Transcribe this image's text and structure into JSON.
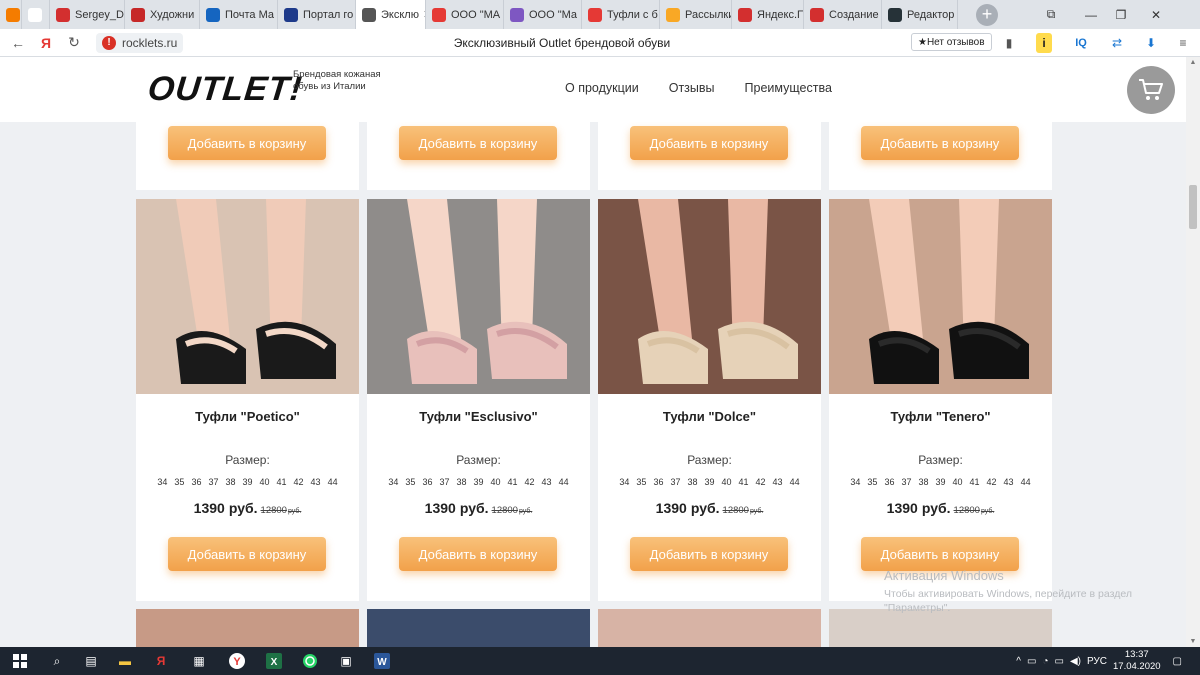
{
  "browser": {
    "tabs": [
      {
        "label": "",
        "favicon_color": "#f57c00",
        "favicon_icon": "blogger-icon"
      },
      {
        "label": "",
        "favicon_color": "#ffffff",
        "favicon_icon": "page-icon"
      },
      {
        "label": "Sergey_D",
        "favicon_color": "#d32f2f",
        "favicon_icon": "pdf-icon"
      },
      {
        "label": "Художни",
        "favicon_color": "#c62828",
        "favicon_icon": "frame-icon"
      },
      {
        "label": "Почта Ма",
        "favicon_color": "#1565c0",
        "favicon_icon": "mail-icon"
      },
      {
        "label": "Портал го",
        "favicon_color": "#1e3a8a",
        "favicon_icon": "flag-icon"
      },
      {
        "label": "Эксклю",
        "favicon_color": "#555555",
        "favicon_icon": "shoe-icon",
        "active": true
      },
      {
        "label": "ООО \"МА",
        "favicon_color": "#e53935",
        "favicon_icon": "yandex-icon"
      },
      {
        "label": "ООО \"Ма",
        "favicon_color": "#7e57c2",
        "favicon_icon": "globe-icon"
      },
      {
        "label": "Туфли с б",
        "favicon_color": "#e53935",
        "favicon_icon": "shop-icon"
      },
      {
        "label": "Рассылки",
        "favicon_color": "#f9a825",
        "favicon_icon": "envelope-icon"
      },
      {
        "label": "Яндекс.П",
        "favicon_color": "#d32f2f",
        "favicon_icon": "yandex-page-icon"
      },
      {
        "label": "Создание",
        "favicon_color": "#d32f2f",
        "favicon_icon": "yandex-page-icon"
      },
      {
        "label": "Редактор",
        "favicon_color": "#263238",
        "favicon_icon": "sparkle-icon"
      }
    ],
    "close_glyph": "✕",
    "new_tab_glyph": "+"
  },
  "addressbar": {
    "url": "rocklets.ru",
    "page_title": "Эксклюзивный Outlet брендовой обуви",
    "reviews_label": "★Нет отзывов",
    "yandex_glyph": "Я",
    "iq_label": "IQ"
  },
  "site": {
    "logo": "OUTLET!",
    "tagline": "Брендовая кожаная обувь из Италии",
    "nav": [
      "О продукции",
      "Отзывы",
      "Преимущества"
    ]
  },
  "cart_button_label": "Добавить в корзину",
  "size_label": "Размер:",
  "sizes": [
    "34",
    "35",
    "36",
    "37",
    "38",
    "39",
    "40",
    "41",
    "42",
    "43",
    "44"
  ],
  "currency": "руб.",
  "products": [
    {
      "name": "Туфли \"Poetico\"",
      "price": "1390",
      "old_price": "12800"
    },
    {
      "name": "Туфли \"Esclusivo\"",
      "price": "1390",
      "old_price": "12800"
    },
    {
      "name": "Туфли \"Dolce\"",
      "price": "1390",
      "old_price": "12800"
    },
    {
      "name": "Туфли \"Tenero\"",
      "price": "1390",
      "old_price": "12800"
    }
  ],
  "activation": {
    "title": "Активация Windows",
    "text": "Чтобы активировать Windows, перейдите в раздел \"Параметры\"."
  },
  "taskbar": {
    "lang": "РУС",
    "time": "13:37",
    "date": "17.04.2020"
  }
}
